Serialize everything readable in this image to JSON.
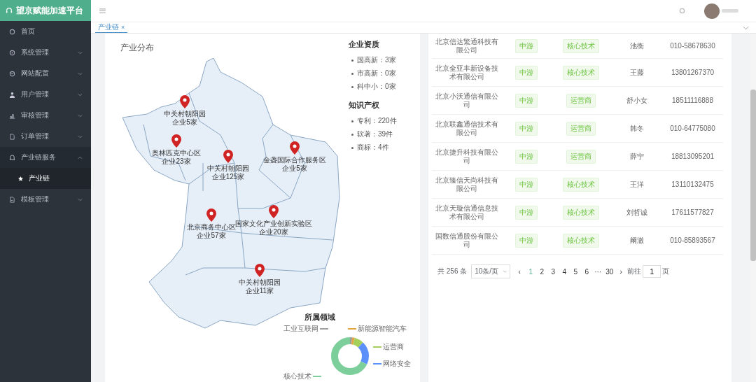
{
  "app": {
    "title": "望京赋能加速平台"
  },
  "sidebar": {
    "items": [
      {
        "label": "首页",
        "expandable": false,
        "selected": false
      },
      {
        "label": "系统管理",
        "expandable": true,
        "expanded": false,
        "selected": false
      },
      {
        "label": "网站配置",
        "expandable": true,
        "expanded": false,
        "selected": false
      },
      {
        "label": "用户管理",
        "expandable": true,
        "expanded": false,
        "selected": false
      },
      {
        "label": "审核管理",
        "expandable": true,
        "expanded": false,
        "selected": false
      },
      {
        "label": "订单管理",
        "expandable": true,
        "expanded": false,
        "selected": false
      },
      {
        "label": "产业链服务",
        "expandable": true,
        "expanded": true,
        "selected": false,
        "children": [
          {
            "label": "产业链",
            "selected": true
          }
        ]
      },
      {
        "label": "模板管理",
        "expandable": true,
        "expanded": false,
        "selected": false
      }
    ]
  },
  "tabs": [
    {
      "label": "产业链",
      "close": "×",
      "selected": true
    }
  ],
  "distribution": {
    "title": "产业分布",
    "markers": [
      {
        "name": "中关村朝阳园",
        "count": "企业5家"
      },
      {
        "name": "奥林匹克中心区",
        "count": "企业23家"
      },
      {
        "name": "中关村朝阳园",
        "count": "企业125家"
      },
      {
        "name": "金盏国际合作服务区",
        "count": "企业5家"
      },
      {
        "name": "北京商务中心区",
        "count": "企业57家"
      },
      {
        "name": "国家文化产业创新实验区",
        "count": "企业20家"
      },
      {
        "name": "中关村朝阳园",
        "count": "企业11家"
      }
    ],
    "stat_groups": [
      {
        "title": "企业资质",
        "items": [
          "国高新：3家",
          "市高新：0家",
          "科中小：0家"
        ]
      },
      {
        "title": "知识产权",
        "items": [
          "专利：220件",
          "软著：39件",
          "商标：4件"
        ]
      }
    ],
    "domains": {
      "title": "所属领域",
      "labels": [
        {
          "text": "工业互联网",
          "color": "#9e9e9e"
        },
        {
          "text": "新能源智能汽车",
          "color": "#e6a23c"
        },
        {
          "text": "运营商",
          "color": "#a5cf5b"
        },
        {
          "text": "网络安全",
          "color": "#5b8ff9"
        },
        {
          "text": "核心技术",
          "color": "#7ccf9a"
        }
      ]
    }
  },
  "companies": {
    "rows": [
      {
        "name": "北京信达繁通科技有限公司",
        "stream": "中游",
        "category": "核心技术",
        "contact": "池衡",
        "phone": "010-58678630"
      },
      {
        "name": "北京全亚丰新设备技术有限公司",
        "stream": "中游",
        "category": "核心技术",
        "contact": "王藤",
        "phone": "13801267370"
      },
      {
        "name": "北京小沃通信有限公司",
        "stream": "中游",
        "category": "运营商",
        "contact": "舒小女",
        "phone": "18511116888"
      },
      {
        "name": "北京联鑫通信技术有限公司",
        "stream": "中游",
        "category": "运营商",
        "contact": "韩冬",
        "phone": "010-64775080"
      },
      {
        "name": "北京捷升科技有限公司",
        "stream": "中游",
        "category": "运营商",
        "contact": "薛宁",
        "phone": "18813095201"
      },
      {
        "name": "北京臻信天尚科技有限公司",
        "stream": "中游",
        "category": "核心技术",
        "contact": "王洋",
        "phone": "13110132475"
      },
      {
        "name": "北京天璇信通信息技术有限公司",
        "stream": "中游",
        "category": "核心技术",
        "contact": "刘哲诚",
        "phone": "17611577827"
      },
      {
        "name": "国数信通股份有限公司",
        "stream": "中游",
        "category": "核心技术",
        "contact": "阚澈",
        "phone": "010-85893567"
      }
    ],
    "pagination": {
      "total": "共 256 条",
      "page_size": "10条/页",
      "prev": "‹",
      "pages": [
        {
          "label": "1",
          "selected": true
        },
        {
          "label": "2",
          "selected": false
        },
        {
          "label": "3",
          "selected": false
        },
        {
          "label": "4",
          "selected": false
        },
        {
          "label": "5",
          "selected": false
        },
        {
          "label": "6",
          "selected": false
        },
        {
          "label": "···",
          "selected": false
        },
        {
          "label": "30",
          "selected": false
        }
      ],
      "next": "›",
      "goto_label": "前往",
      "goto_value": "1",
      "goto_unit": "页"
    }
  }
}
